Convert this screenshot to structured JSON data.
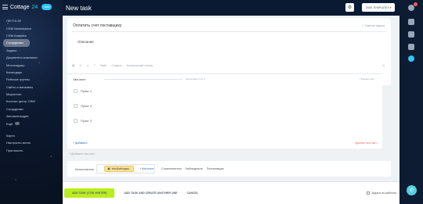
{
  "app": {
    "name": "Cottage",
    "number": "24",
    "tag": "NEW"
  },
  "sidebar": {
    "items": [
      {
        "label": "ЛЕНТА 98"
      },
      {
        "label": "CRM Marketplace"
      },
      {
        "label": "CRM Analytics"
      },
      {
        "label": "Сотрудники"
      },
      {
        "label": "Задачи"
      },
      {
        "label": "Документы компании"
      },
      {
        "label": "Мессенджер"
      },
      {
        "label": "Календарь"
      },
      {
        "label": "Рабочие группы"
      },
      {
        "label": "Сайты и магазины"
      },
      {
        "label": "Маркетинг"
      },
      {
        "label": "Контакт-центр CRM"
      },
      {
        "label": "Сотрудники"
      },
      {
        "label": "Автоматизация"
      },
      {
        "label": "Ещё",
        "count": "7"
      }
    ],
    "bottom": [
      {
        "label": "Карта"
      },
      {
        "label": "Настроить меню"
      },
      {
        "label": "Пригласить"
      }
    ]
  },
  "header": {
    "title": "New task",
    "templates_label": "TASK TEMPLATES ▾"
  },
  "task": {
    "title": "Оплатить счет поставщику",
    "priority_label": "Важная задача",
    "description": "Описание",
    "editor_tools": [
      "Файл",
      "Создать",
      "Контрольный список"
    ],
    "ai_label": "А"
  },
  "checklist": {
    "name": "Чек-лист",
    "progress": "выполнено 0 из 3",
    "actions": "Показать все",
    "items": [
      "Пункт 1",
      "Пункт 2",
      "Пункт 3"
    ],
    "add_label": "+ Добавить",
    "remove_label": "Удалить чек-лист"
  },
  "add_checklist_label": "+ Добавить чек-лист",
  "people": {
    "label": "Исполнитель",
    "assignee": "info@vikingsa...",
    "add_more": "+ Add more",
    "others": [
      "Соисполнители",
      "Наблюдатели",
      "Постановщик"
    ]
  },
  "footer": {
    "primary": "ADD TASK (CTRL+ENTER)",
    "secondary": "ADD TASK AND CREATE ANOTHER ONE",
    "cancel": "CANCEL",
    "checkbox_label": "Задача из шаблона"
  },
  "rail": {
    "badge": "1"
  }
}
